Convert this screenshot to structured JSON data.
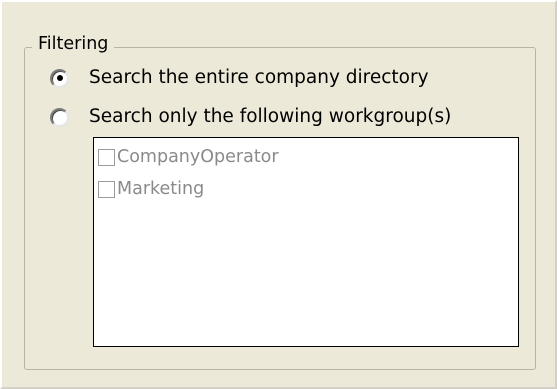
{
  "filtering": {
    "legend": "Filtering",
    "options": [
      {
        "label": "Search the entire company directory",
        "selected": true
      },
      {
        "label": "Search only the following workgroup(s)",
        "selected": false
      }
    ],
    "workgroups": [
      {
        "label": "CompanyOperator",
        "checked": false
      },
      {
        "label": "Marketing",
        "checked": false
      }
    ]
  },
  "colors": {
    "window_bg": "#ece9d8",
    "listbox_bg": "#ffffff",
    "disabled_text": "#8a8a8a"
  }
}
